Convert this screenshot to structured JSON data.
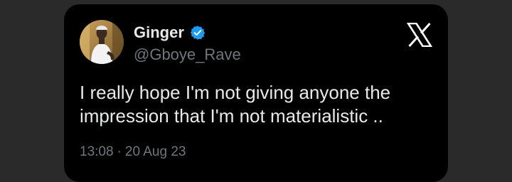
{
  "tweet": {
    "author": {
      "name": "Ginger",
      "handle": "@Gboye_Rave",
      "verified": true
    },
    "text": "I really hope I'm not giving anyone the impression that I'm not materialistic ..",
    "time": "13:08",
    "separator": "·",
    "date": "20 Aug 23"
  },
  "icons": {
    "verified": "verified-badge-icon",
    "brand": "x-logo-icon"
  },
  "colors": {
    "card_bg": "#000000",
    "page_bg": "#2a2a2a",
    "text_primary": "#e7e9ea",
    "text_secondary": "#71767b",
    "verified_blue": "#1d9bf0"
  }
}
